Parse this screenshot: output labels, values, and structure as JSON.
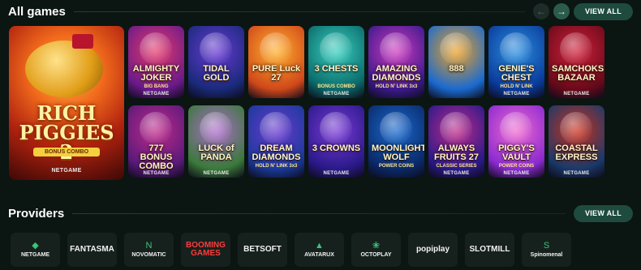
{
  "games_section": {
    "title": "All games",
    "prev_icon": "chevron-left-icon",
    "next_icon": "chevron-right-icon",
    "prev_glyph": "←",
    "next_glyph": "→",
    "view_all_label": "VIEW ALL"
  },
  "featured_game": {
    "title": "RICH PIGGIES 2",
    "subtitle": "BONUS COMBO",
    "provider": "NETGAME"
  },
  "games": [
    {
      "title": "ALMIGHTY JOKER",
      "subtitle": "BIG BANG",
      "provider": "NETGAME",
      "colors": [
        "#6a1a8a",
        "#e63a6a"
      ]
    },
    {
      "title": "TIDAL GOLD",
      "subtitle": "",
      "provider": "",
      "colors": [
        "#1a2a7a",
        "#6a3ad6"
      ]
    },
    {
      "title": "PURE Luck 27",
      "subtitle": "",
      "provider": "",
      "colors": [
        "#d0481a",
        "#ffb12e"
      ]
    },
    {
      "title": "3 CHESTS",
      "subtitle": "BONUS COMBO",
      "provider": "NETGAME",
      "colors": [
        "#0a6a6a",
        "#3ad0c0"
      ]
    },
    {
      "title": "AMAZING DIAMONDS",
      "subtitle": "HOLD N' LINK 3x3",
      "provider": "",
      "colors": [
        "#3a1a8a",
        "#d03ac0"
      ]
    },
    {
      "title": "888",
      "subtitle": "",
      "provider": "",
      "colors": [
        "#1a6ad0",
        "#f0a020"
      ]
    },
    {
      "title": "GENIE'S CHEST",
      "subtitle": "HOLD N' LINK",
      "provider": "NETGAME",
      "colors": [
        "#0a3a9a",
        "#2a90e0"
      ]
    },
    {
      "title": "SAMCHOKS BAZAAR",
      "subtitle": "",
      "provider": "NETGAME",
      "colors": [
        "#6a0a1a",
        "#d0203a"
      ]
    },
    {
      "title": "777 BONUS COMBO",
      "subtitle": "",
      "provider": "NETGAME",
      "colors": [
        "#5a1a7a",
        "#c02a8a"
      ]
    },
    {
      "title": "LUCK of PANDA",
      "subtitle": "",
      "provider": "NETGAME",
      "colors": [
        "#3a7a3a",
        "#b06ad0"
      ]
    },
    {
      "title": "DREAM DIAMONDS",
      "subtitle": "HOLD N' LINK 3x3",
      "provider": "",
      "colors": [
        "#1a3a9a",
        "#6a3ad0"
      ]
    },
    {
      "title": "3 CROWNS",
      "subtitle": "",
      "provider": "NETGAME",
      "colors": [
        "#2a1a8a",
        "#7a3ad6"
      ]
    },
    {
      "title": "MOONLIGHT WOLF",
      "subtitle": "POWER COINS",
      "provider": "",
      "colors": [
        "#0a2a6a",
        "#1a6ad0"
      ]
    },
    {
      "title": "ALWAYS FRUITS 27",
      "subtitle": "CLASSIC SERIES",
      "provider": "NETGAME",
      "colors": [
        "#2a1a8a",
        "#c02a8a"
      ]
    },
    {
      "title": "PIGGY'S VAULT",
      "subtitle": "POWER COINS",
      "provider": "NETGAME",
      "colors": [
        "#8a2ad0",
        "#f06ad0"
      ]
    },
    {
      "title": "COASTAL EXPRESS",
      "subtitle": "",
      "provider": "NETGAME",
      "colors": [
        "#1a3a6a",
        "#d0301a"
      ]
    }
  ],
  "providers_section": {
    "title": "Providers",
    "view_all_label": "VIEW ALL"
  },
  "providers": [
    {
      "name": "NETGAME",
      "glyph": "◆"
    },
    {
      "name": "FANTASMA",
      "glyph": ""
    },
    {
      "name": "NOVOMATIC",
      "glyph": "N"
    },
    {
      "name": "BOOMING GAMES",
      "glyph": ""
    },
    {
      "name": "BETSOFT",
      "glyph": ""
    },
    {
      "name": "AVATARUX",
      "glyph": "▲"
    },
    {
      "name": "OCTOPLAY",
      "glyph": "❀"
    },
    {
      "name": "popiplay",
      "glyph": ""
    },
    {
      "name": "SLOTMILL",
      "glyph": ""
    },
    {
      "name": "Spinomenal",
      "glyph": "S"
    }
  ]
}
